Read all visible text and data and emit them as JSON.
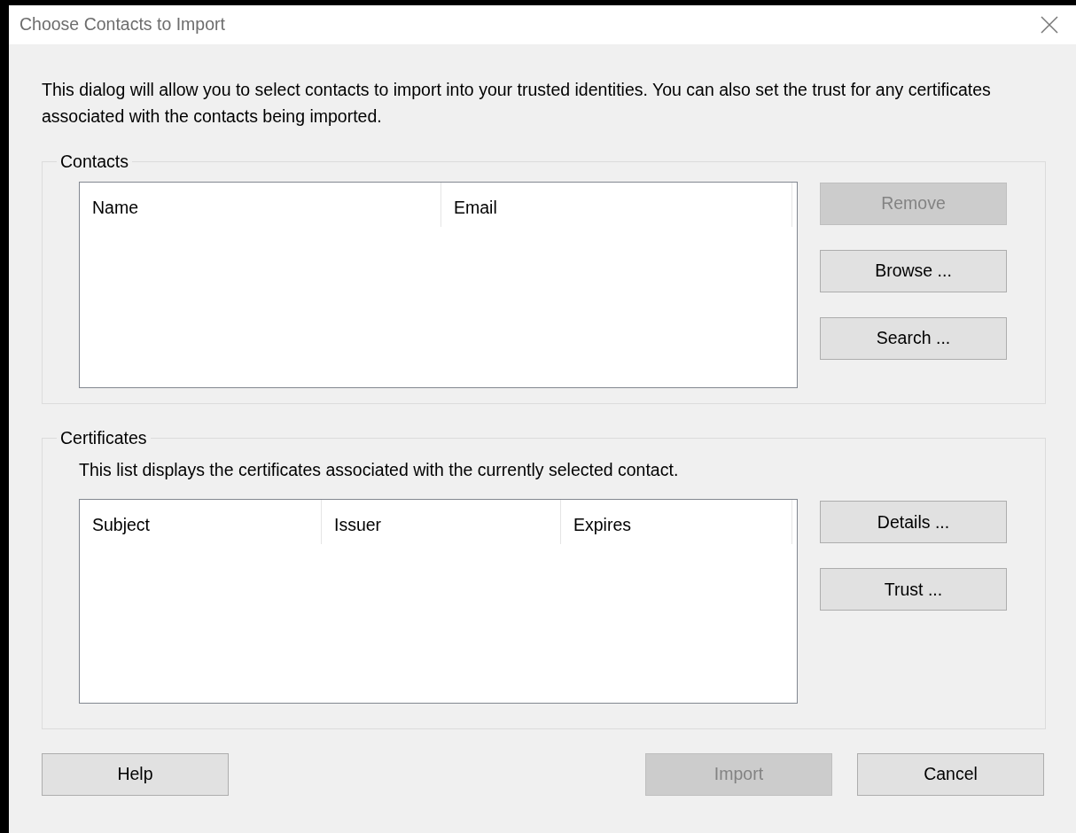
{
  "window": {
    "title": "Choose Contacts to Import"
  },
  "intro": "This dialog will allow you to select contacts to import into your trusted identities. You can also set the trust for any certificates associated with the contacts being imported.",
  "contacts": {
    "label": "Contacts",
    "columns": [
      "Name",
      "Email"
    ],
    "buttons": [
      {
        "label": "Remove",
        "disabled": true
      },
      {
        "label": "Browse ...",
        "disabled": false
      },
      {
        "label": "Search ...",
        "disabled": false
      }
    ]
  },
  "certificates": {
    "label": "Certificates",
    "description": "This list displays the certificates associated with the currently selected contact.",
    "columns": [
      "Subject",
      "Issuer",
      "Expires"
    ],
    "buttons": [
      {
        "label": "Details ...",
        "disabled": false
      },
      {
        "label": "Trust ...",
        "disabled": false
      }
    ]
  },
  "footer": {
    "buttons": [
      {
        "label": "Help",
        "disabled": false
      },
      {
        "label": "Import",
        "disabled": true
      },
      {
        "label": "Cancel",
        "disabled": false
      }
    ]
  }
}
